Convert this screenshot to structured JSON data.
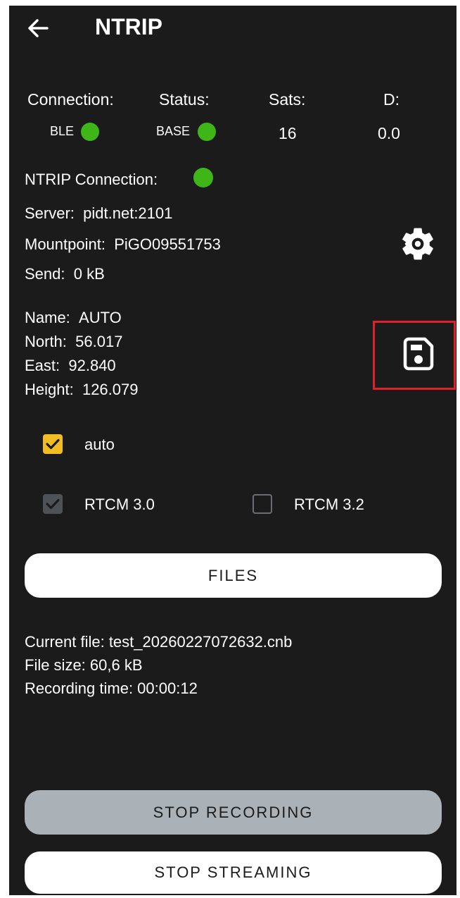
{
  "header": {
    "title": "NTRIP",
    "back_icon": "arrow-left-icon"
  },
  "status_columns": [
    {
      "label": "Connection:",
      "value": "BLE",
      "indicator": "green"
    },
    {
      "label": "Status:",
      "value": "BASE",
      "indicator": "green"
    },
    {
      "label": "Sats:",
      "value": "16"
    },
    {
      "label": "D:",
      "value": "0.0"
    }
  ],
  "ntrip": {
    "connection_label": "NTRIP Connection:",
    "indicator": "green",
    "server_label": "Server:",
    "server_value": "pidt.net:2101",
    "mountpoint_label": "Mountpoint:",
    "mountpoint_value": "PiGO09551753",
    "send_label": "Send:",
    "send_value": "0 kB"
  },
  "position": {
    "name_label": "Name:",
    "name_value": "AUTO",
    "north_label": "North:",
    "north_value": "56.017",
    "east_label": "East:",
    "east_value": "92.840",
    "height_label": "Height:",
    "height_value": "126.079"
  },
  "options": {
    "auto": {
      "label": "auto",
      "checked": true
    },
    "rtcm30": {
      "label": "RTCM 3.0",
      "checked": true,
      "disabled": true
    },
    "rtcm32": {
      "label": "RTCM 3.2",
      "checked": false
    }
  },
  "buttons": {
    "files": "FILES",
    "stop_recording": "STOP RECORDING",
    "stop_streaming": "STOP STREAMING"
  },
  "recording": {
    "current_file": "Current file: test_20260227072632.cnb",
    "file_size": "File size: 60,6 kB",
    "recording_time": "Recording time: 00:00:12"
  },
  "icons": {
    "settings": "gear-icon",
    "save": "save-icon"
  },
  "colors": {
    "background": "#1b1b1b",
    "status_green": "#3fb618",
    "checkbox_yellow": "#f2bd22",
    "highlight_red": "#e0202a",
    "disabled_button": "#aab2b8"
  }
}
